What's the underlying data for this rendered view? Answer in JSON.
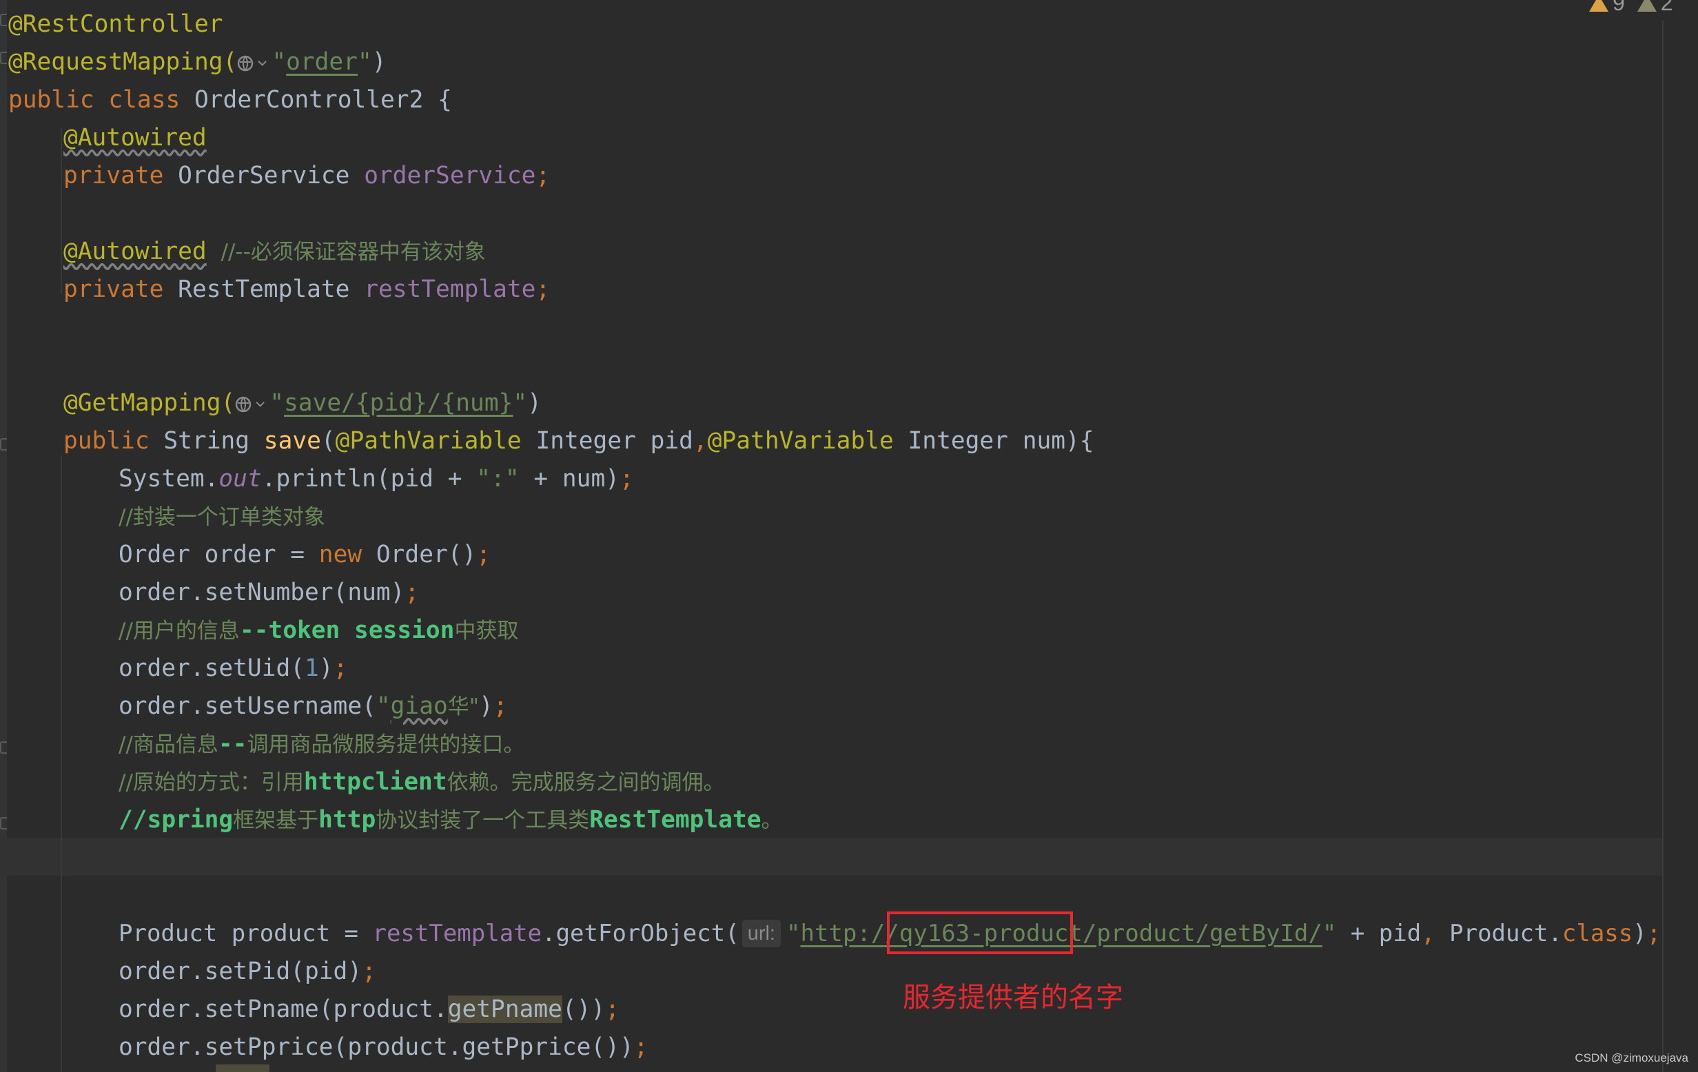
{
  "inspections": {
    "warnings": "9",
    "weak_warnings": "2"
  },
  "lines": {
    "l1": "@RestController",
    "l2_ann": "@RequestMapping(",
    "l2_url": "order",
    "l3_public": "public class",
    "l3_name": " OrderController2 {",
    "l4": "@Autowired",
    "l5_kw": "private",
    "l5_type": " OrderService ",
    "l5_field": "orderService",
    "l7_ann": "@Autowired",
    "l7_comment": "//--必须保证容器中有该对象",
    "l8_kw": "private",
    "l8_type": " RestTemplate ",
    "l8_field": "restTemplate",
    "l11_ann": "@GetMapping(",
    "l11_url": "save/{pid}/{num}",
    "l12_public": "public",
    "l12_type": " String ",
    "l12_method": "save",
    "l12_pv1": "@PathVariable",
    "l12_arg1": " Integer pid",
    "l12_pv2": "@PathVariable",
    "l12_arg2": " Integer num){",
    "l13_a": "System.",
    "l13_out": "out",
    "l13_b": ".println(pid + ",
    "l13_str": "\":\"",
    "l13_c": " + num)",
    "l14": "//封装一个订单类对象",
    "l15_a": "Order order = ",
    "l15_new": "new",
    "l15_b": " Order()",
    "l16": "order.setNumber(num)",
    "l17_a": "//用户的信息",
    "l17_b": "--token session",
    "l17_c": "中获取",
    "l18_a": "order.setUid(",
    "l18_num": "1",
    "l18_b": ")",
    "l19_a": "order.setUsername(",
    "l19_q1": "\"",
    "l19_sq": "giao",
    "l19_rest": "华\"",
    "l19_b": ")",
    "l20_a": "//商品信息",
    "l20_b": "--",
    "l20_c": "调用商品微服务提供的接口。",
    "l21_a": "//原始的方式：引用",
    "l21_b": "httpclient",
    "l21_c": "依赖。完成服务之间的调佣。",
    "l22_a": "//",
    "l22_b": "spring",
    "l22_c": "框架基于",
    "l22_d": "http",
    "l22_e": "协议封装了一个工具类",
    "l22_f": "RestTemplate",
    "l22_g": "。",
    "l25_a": "Product product = ",
    "l25_field": "restTemplate",
    "l25_b": ".getForObject(",
    "l25_hint": "url:",
    "l25_q1": "\"",
    "l25_url": "http://qy163-product/product/getById/",
    "l25_q2": "\"",
    "l25_c": " + pid",
    "l25_d": " Product.",
    "l25_class": "class",
    "l25_e": ")",
    "l26": "order.setPid(pid)",
    "l27_a": "order.setPname(product.",
    "l27_hl": "getPname",
    "l27_b": "())",
    "l28": "order.setPprice(product.getPprice())"
  },
  "annotation": {
    "label": "服务提供者的名字"
  },
  "watermark": "CSDN @zimoxuejava",
  "colors": {
    "background": "#2b2b2b",
    "keyword": "#cc7832",
    "annotation": "#bbb529",
    "field": "#9876aa",
    "string": "#6a8759",
    "method": "#ffc66d",
    "highlight_box": "#e8282e"
  }
}
